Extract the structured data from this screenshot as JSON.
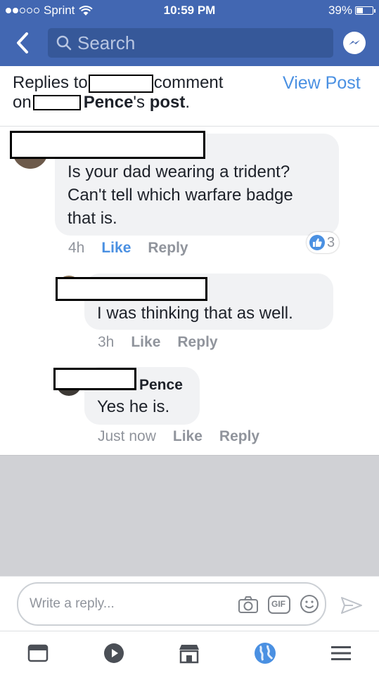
{
  "status_bar": {
    "carrier": "Sprint",
    "time": "10:59 PM",
    "battery": "39%",
    "battery_level": 0.39
  },
  "nav": {
    "search_placeholder": "Search"
  },
  "header": {
    "replies_to": "Replies to",
    "comment": "comment",
    "on": "on",
    "name_suffix": "Pence",
    "possessive": "'s",
    "post": "post",
    "period": ".",
    "view_post": "View Post"
  },
  "comments": [
    {
      "text_lines": [
        "Is your dad wearing a trident?",
        "Can't tell which warfare badge",
        "that is."
      ],
      "time": "4h",
      "like": "Like",
      "reply": "Reply",
      "reaction_count": "3",
      "liked": true
    },
    {
      "text": "I was thinking that as well.",
      "time": "3h",
      "like": "Like",
      "reply": "Reply"
    },
    {
      "author_suffix": "Pence",
      "text": "Yes he is.",
      "time": "Just now",
      "like": "Like",
      "reply": "Reply"
    }
  ],
  "composer": {
    "placeholder": "Write a reply...",
    "gif_label": "GIF"
  },
  "colors": {
    "brand": "#4267b2",
    "link": "#4a90e2",
    "bubble": "#f1f2f4",
    "muted": "#90949c"
  },
  "icons": {
    "back": "chevron-left-icon",
    "search": "search-icon",
    "messenger": "messenger-icon",
    "camera": "camera-icon",
    "gif": "gif-icon",
    "emoji": "smiley-icon",
    "send": "send-icon",
    "tabs": [
      "news-feed-icon",
      "video-icon",
      "marketplace-icon",
      "notifications-globe-icon",
      "menu-icon"
    ]
  }
}
